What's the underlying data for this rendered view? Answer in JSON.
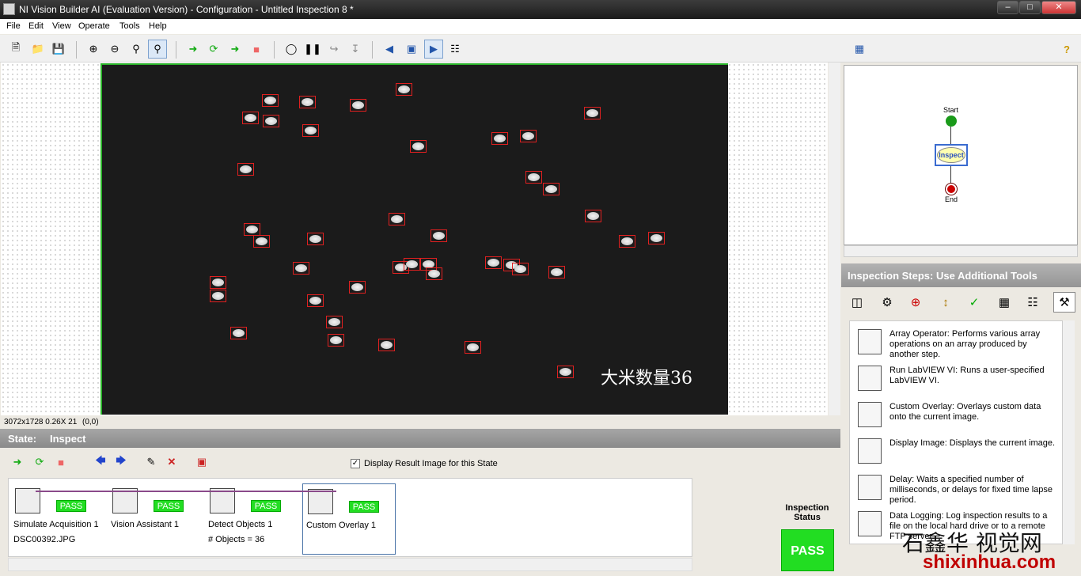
{
  "window": {
    "title": "NI Vision Builder AI (Evaluation Version) - Configuration - Untitled Inspection 8 *"
  },
  "menu": [
    "File",
    "Edit",
    "View",
    "Operate",
    "Tools",
    "Help"
  ],
  "image": {
    "caption": "大米数量36"
  },
  "status": {
    "image_info": "3072x1728 0.26X 21",
    "coords": "(0,0)"
  },
  "state": {
    "label": "State:",
    "name": "Inspect"
  },
  "display_result_checkbox": {
    "label": "Display Result Image for this State",
    "checked": true
  },
  "steps": [
    {
      "name": "Simulate Acquisition 1",
      "sub": "DSC00392.JPG",
      "result": "PASS"
    },
    {
      "name": "Vision Assistant 1",
      "sub": "",
      "result": "PASS"
    },
    {
      "name": "Detect Objects 1",
      "sub": "# Objects = 36",
      "result": "PASS"
    },
    {
      "name": "Custom Overlay 1",
      "sub": "",
      "result": "PASS"
    }
  ],
  "inspection_status": {
    "label": "Inspection Status",
    "value": "PASS"
  },
  "flow": {
    "start": "Start",
    "inspect": "Inspect",
    "end": "End"
  },
  "steps_panel": {
    "title": "Inspection Steps: Use Additional Tools"
  },
  "tools": [
    {
      "text": "Array Operator:  Performs various array operations on an array produced by another step."
    },
    {
      "text": "Run LabVIEW VI:  Runs a user-specified LabVIEW VI."
    },
    {
      "text": "Custom Overlay:  Overlays custom data onto the current image."
    },
    {
      "text": "Display Image:  Displays the current image."
    },
    {
      "text": "Delay:  Waits a specified number of milliseconds, or delays for fixed time lapse period."
    },
    {
      "text": "Data Logging:  Log inspection results to a file on the local hard drive or to a remote FTP server."
    }
  ],
  "watermark": {
    "cn": "石鑫华 视觉网",
    "url": "shixinhua.com"
  }
}
